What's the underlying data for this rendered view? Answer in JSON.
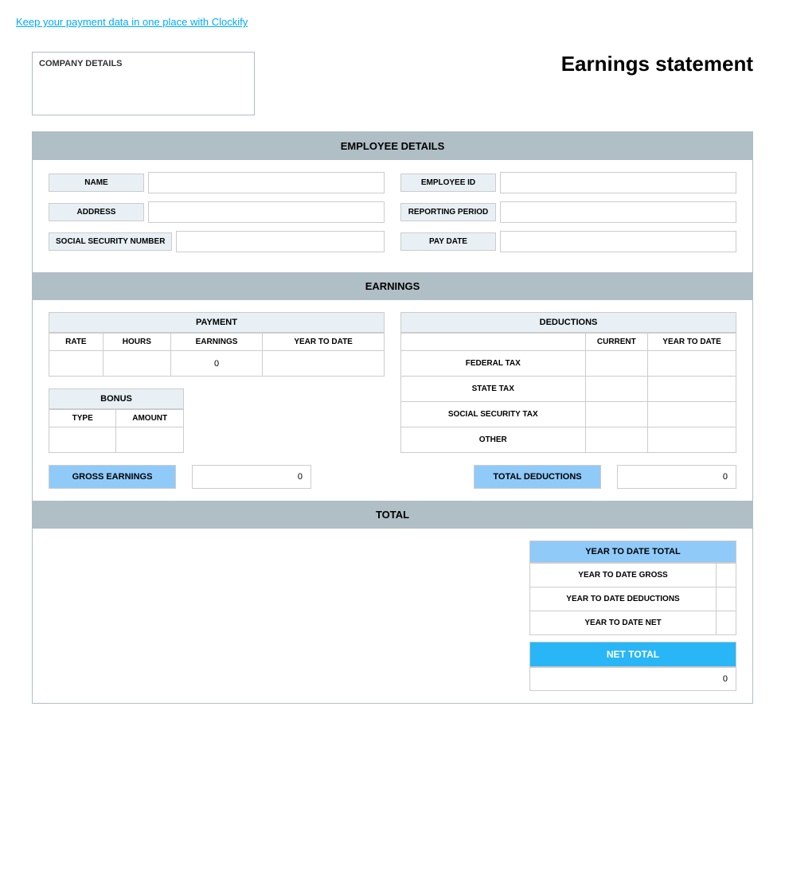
{
  "topLink": {
    "text": "Keep your payment data in one place with Clockify"
  },
  "header": {
    "companyLabel": "COMPANY DETAILS",
    "title": "Earnings statement"
  },
  "employeeDetails": {
    "sectionHeader": "EMPLOYEE DETAILS",
    "fields": {
      "nameLabel": "NAME",
      "employeeIdLabel": "EMPLOYEE ID",
      "addressLabel": "ADDRESS",
      "reportingPeriodLabel": "REPORTING PERIOD",
      "socialSecurityLabel": "SOCIAL SECURITY NUMBER",
      "payDateLabel": "PAY DATE"
    }
  },
  "earnings": {
    "sectionHeader": "EARNINGS",
    "payment": {
      "header": "PAYMENT",
      "columns": [
        "RATE",
        "HOURS",
        "EARNINGS",
        "YEAR TO DATE"
      ],
      "row": {
        "rate": "",
        "hours": "",
        "earnings": "0",
        "yearToDate": ""
      }
    },
    "deductions": {
      "header": "DEDUCTIONS",
      "columns": [
        "CURRENT",
        "YEAR TO DATE"
      ],
      "rows": [
        {
          "label": "FEDERAL TAX",
          "current": "",
          "yearToDate": ""
        },
        {
          "label": "STATE TAX",
          "current": "",
          "yearToDate": ""
        },
        {
          "label": "SOCIAL SECURITY TAX",
          "current": "",
          "yearToDate": ""
        },
        {
          "label": "OTHER",
          "current": "",
          "yearToDate": ""
        }
      ]
    },
    "bonus": {
      "header": "BONUS",
      "columns": [
        "TYPE",
        "AMOUNT"
      ],
      "row": {
        "type": "",
        "amount": ""
      }
    },
    "grossEarningsLabel": "GROSS EARNINGS",
    "grossEarningsValue": "0",
    "totalDeductionsLabel": "TOTAL DEDUCTIONS",
    "totalDeductionsValue": "0"
  },
  "total": {
    "sectionHeader": "TOTAL",
    "ytdTotal": {
      "header": "YEAR TO DATE TOTAL",
      "rows": [
        {
          "label": "YEAR TO DATE GROSS",
          "value": ""
        },
        {
          "label": "YEAR TO DATE DEDUCTIONS",
          "value": ""
        },
        {
          "label": "YEAR TO DATE NET",
          "value": ""
        }
      ]
    },
    "netTotalHeader": "NET TOTAL",
    "netTotalValue": "0"
  }
}
